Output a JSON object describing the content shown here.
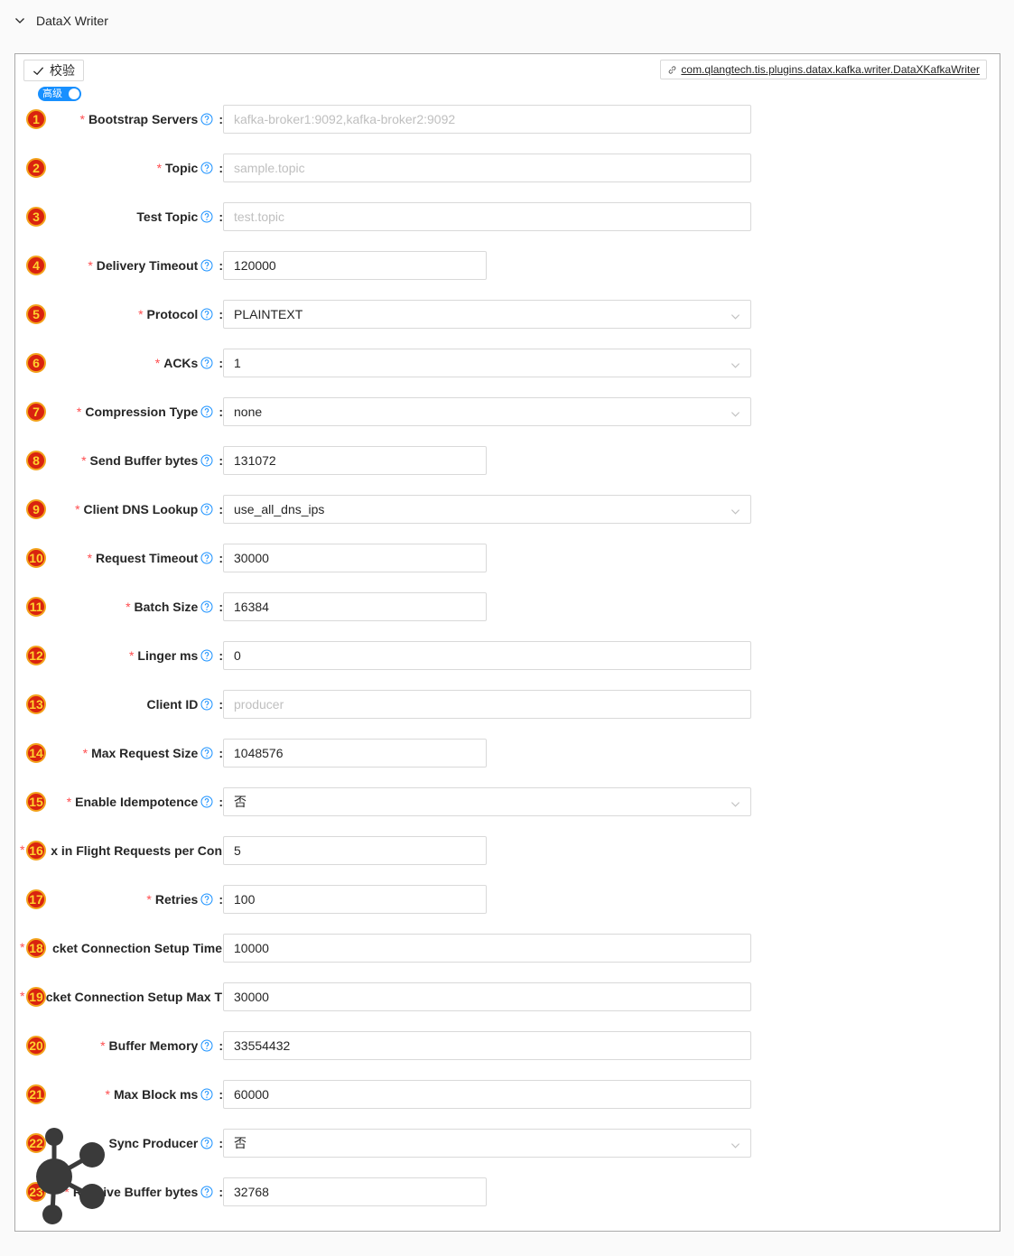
{
  "panel": {
    "title": "DataX Writer"
  },
  "toolbar": {
    "verify_label": "校验",
    "plugin_link": "com.qlangtech.tis.plugins.datax.kafka.writer.DataXKafkaWriter",
    "advanced_label": "高级"
  },
  "fields": [
    {
      "num": "1",
      "label": "Bootstrap Servers",
      "required": true,
      "value": "",
      "placeholder": "kafka-broker1:9092,kafka-broker2:9092",
      "type": "input",
      "width": "wide"
    },
    {
      "num": "2",
      "label": "Topic",
      "required": true,
      "value": "",
      "placeholder": "sample.topic",
      "type": "input",
      "width": "wide"
    },
    {
      "num": "3",
      "label": "Test Topic",
      "required": false,
      "value": "",
      "placeholder": "test.topic",
      "type": "input",
      "width": "wide"
    },
    {
      "num": "4",
      "label": "Delivery Timeout",
      "required": true,
      "value": "120000",
      "type": "input",
      "width": "narrow"
    },
    {
      "num": "5",
      "label": "Protocol",
      "required": true,
      "value": "PLAINTEXT",
      "type": "select",
      "width": "wide"
    },
    {
      "num": "6",
      "label": "ACKs",
      "required": true,
      "value": "1",
      "type": "select",
      "width": "wide"
    },
    {
      "num": "7",
      "label": "Compression Type",
      "required": true,
      "value": "none",
      "type": "select",
      "width": "wide"
    },
    {
      "num": "8",
      "label": "Send Buffer bytes",
      "required": true,
      "value": "131072",
      "type": "input",
      "width": "narrow"
    },
    {
      "num": "9",
      "label": "Client DNS Lookup",
      "required": true,
      "value": "use_all_dns_ips",
      "type": "select",
      "width": "wide"
    },
    {
      "num": "10",
      "label": "Request Timeout",
      "required": true,
      "value": "30000",
      "type": "input",
      "width": "narrow"
    },
    {
      "num": "11",
      "label": "Batch Size",
      "required": true,
      "value": "16384",
      "type": "input",
      "width": "narrow"
    },
    {
      "num": "12",
      "label": "Linger ms",
      "required": true,
      "value": "0",
      "type": "input",
      "width": "wide"
    },
    {
      "num": "13",
      "label": "Client ID",
      "required": false,
      "value": "",
      "placeholder": "producer",
      "type": "input",
      "width": "wide"
    },
    {
      "num": "14",
      "label": "Max Request Size",
      "required": true,
      "value": "1048576",
      "type": "input",
      "width": "narrow"
    },
    {
      "num": "15",
      "label": "Enable Idempotence",
      "required": true,
      "value": "否",
      "type": "select",
      "width": "wide"
    },
    {
      "num": "16",
      "label": "x in Flight Requests per Con",
      "required": true,
      "value": "5",
      "type": "input",
      "width": "narrow",
      "clipped": true
    },
    {
      "num": "17",
      "label": "Retries",
      "required": true,
      "value": "100",
      "type": "input",
      "width": "narrow"
    },
    {
      "num": "18",
      "label": "cket Connection Setup Time",
      "required": true,
      "value": "10000",
      "type": "input",
      "width": "wide",
      "clipped": true
    },
    {
      "num": "19",
      "label": "cket Connection Setup Max T",
      "required": true,
      "value": "30000",
      "type": "input",
      "width": "wide",
      "clipped": true
    },
    {
      "num": "20",
      "label": "Buffer Memory",
      "required": true,
      "value": "33554432",
      "type": "input",
      "width": "wide"
    },
    {
      "num": "21",
      "label": "Max Block ms",
      "required": true,
      "value": "60000",
      "type": "input",
      "width": "wide"
    },
    {
      "num": "22",
      "label": "Sync Producer",
      "required": false,
      "value": "否",
      "type": "select",
      "width": "wide"
    },
    {
      "num": "23",
      "label": "Receive Buffer bytes",
      "required": true,
      "value": "32768",
      "type": "input",
      "width": "narrow"
    }
  ],
  "colors": {
    "required": "#ff4d4f",
    "help": "#1890ff",
    "badge_fill": "#d9230f",
    "badge_text": "#ffd22e",
    "toggle": "#1890ff"
  }
}
